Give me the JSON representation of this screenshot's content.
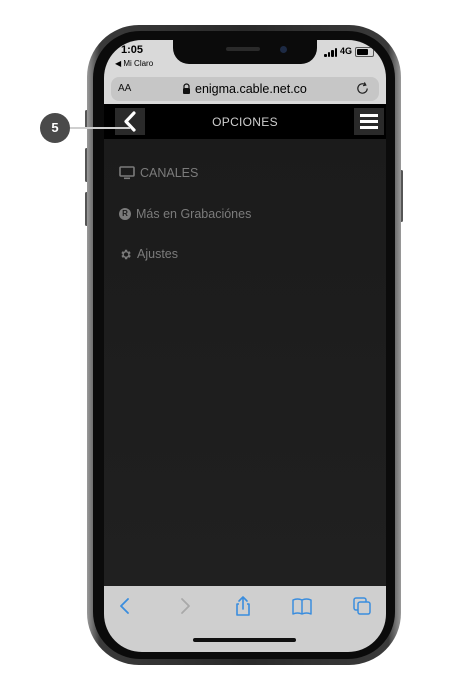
{
  "status": {
    "time": "1:05",
    "carrier": "◀ Mi Claro",
    "network": "4G"
  },
  "browser": {
    "text_size_label": "AA",
    "domain": "enigma.cable.net.co"
  },
  "app": {
    "title": "OPCIONES"
  },
  "menu": {
    "items": [
      {
        "label": "CANALES",
        "icon": "tv-icon"
      },
      {
        "label": "Más en Grabaciónes",
        "icon": "r-badge-icon",
        "badge": "R"
      },
      {
        "label": "Ajustes",
        "icon": "gear-icon"
      }
    ]
  },
  "annotation": {
    "step": "5"
  },
  "colors": {
    "accent": "#3a8dde",
    "screen_bg": "#1b1b1b",
    "appbar_bg": "#000000",
    "menu_text": "#7b7b7b"
  }
}
